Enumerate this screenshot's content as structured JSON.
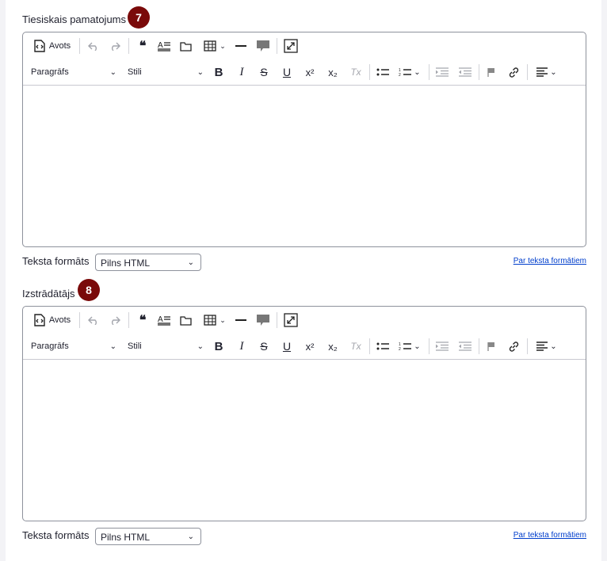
{
  "fields": [
    {
      "label": "Tiesiskais pamatojums",
      "badge": "7",
      "source_label": "Avots",
      "paragraph_label": "Paragrāfs",
      "styles_label": "Stili",
      "format_label": "Teksta formāts",
      "format_value": "Pilns HTML",
      "format_link": "Par teksta formātiem"
    },
    {
      "label": "Izstrādātājs",
      "badge": "8",
      "source_label": "Avots",
      "paragraph_label": "Paragrāfs",
      "styles_label": "Stili",
      "format_label": "Teksta formāts",
      "format_value": "Pilns HTML",
      "format_link": "Par teksta formātiem"
    }
  ],
  "icons": {
    "bold": "B",
    "italic": "I",
    "strike": "S",
    "underline": "U",
    "superscript": "x²",
    "subscript": "x₂",
    "remove_format": "Tx"
  },
  "colors": {
    "badge": "#7a0a0a",
    "link": "#003ecc",
    "border": "#8e929c"
  }
}
